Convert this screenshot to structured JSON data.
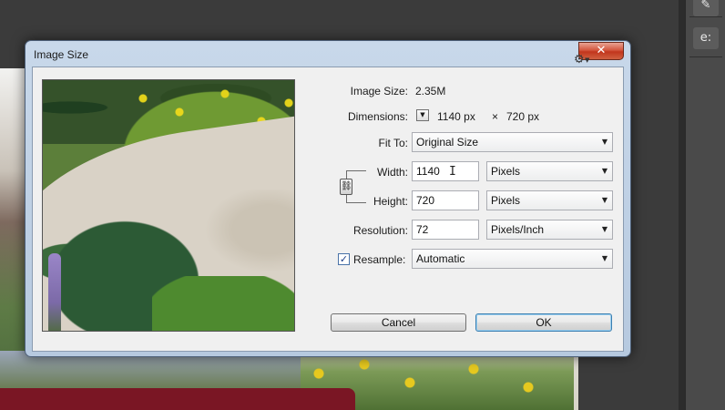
{
  "dialog": {
    "title": "Image Size",
    "close_glyph": "✕"
  },
  "image_size": {
    "label": "Image Size:",
    "value": "2.35M"
  },
  "dimensions": {
    "label": "Dimensions:",
    "width": "1140 px",
    "separator": "×",
    "height": "720 px"
  },
  "fit_to": {
    "label": "Fit To:",
    "value": "Original Size"
  },
  "width": {
    "label": "Width:",
    "value": "1140",
    "unit": "Pixels"
  },
  "height": {
    "label": "Height:",
    "value": "720",
    "unit": "Pixels"
  },
  "resolution": {
    "label": "Resolution:",
    "value": "72",
    "unit": "Pixels/Inch"
  },
  "resample": {
    "label": "Resample:",
    "checked": true,
    "value": "Automatic"
  },
  "buttons": {
    "cancel": "Cancel",
    "ok": "OK"
  },
  "icons": {
    "gear": "gear-icon",
    "dropdown": "chevron-down-icon",
    "link": "chain-link-icon",
    "check": "checkmark-icon",
    "text_cursor": "i-beam-cursor-icon"
  },
  "colors": {
    "title_bar": "#b6c9df",
    "close_button": "#c2361d",
    "dialog_body": "#f0f0f0",
    "ok_focus": "#3c7fb1"
  }
}
